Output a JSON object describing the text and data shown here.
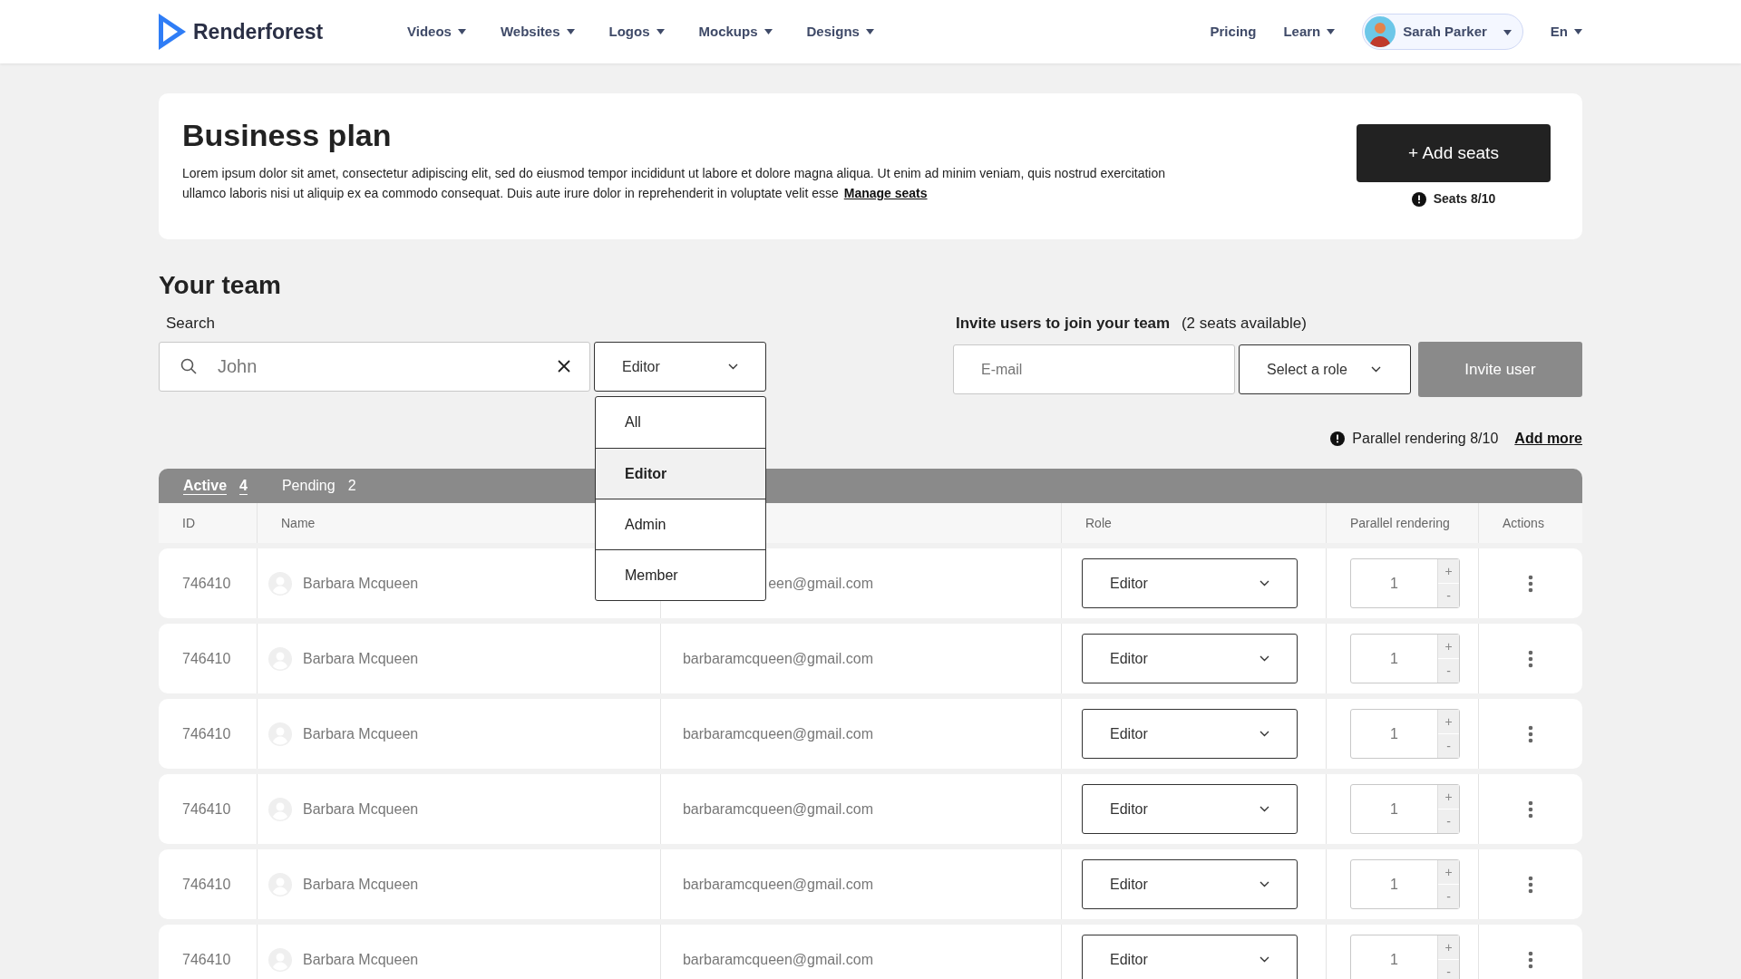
{
  "nav": {
    "logo": "Renderforest",
    "menus": [
      {
        "label": "Videos"
      },
      {
        "label": "Websites"
      },
      {
        "label": "Logos"
      },
      {
        "label": "Mockups"
      },
      {
        "label": "Designs"
      }
    ],
    "links": [
      {
        "label": "Pricing",
        "dropdown": false
      },
      {
        "label": "Learn",
        "dropdown": true
      }
    ],
    "user": {
      "name": "Sarah Parker"
    },
    "language": "En"
  },
  "plan": {
    "title": "Business plan",
    "description": "Lorem ipsum dolor sit amet, consectetur adipiscing elit, sed do eiusmod tempor incididunt ut labore et dolore magna aliqua. Ut enim ad minim veniam, quis nostrud exercitation ullamco laboris nisi ut aliquip ex ea commodo consequat. Duis aute irure dolor in reprehenderit in voluptate velit esse",
    "link": "Manage seats",
    "button": "+ Add seats",
    "seats": "Seats 8/10"
  },
  "team": {
    "title": "Your team",
    "search": {
      "label": "Search",
      "value": "John"
    },
    "filter": {
      "value": "Editor",
      "expanded": true,
      "options": [
        {
          "label": "All",
          "selected": false
        },
        {
          "label": "Editor",
          "selected": true
        },
        {
          "label": "Admin",
          "selected": false
        },
        {
          "label": "Member",
          "selected": false
        }
      ]
    },
    "invite": {
      "title": "Invite users to join your team",
      "note": "(2 seats available)",
      "placeholder": "E-mail",
      "role": "Select a role",
      "button": "Invite user",
      "disabled": true
    },
    "rendering": {
      "text": "Parallel rendering 8/10",
      "link": "Add more"
    },
    "tabs": [
      {
        "label": "Active",
        "count": "4",
        "selected": true
      },
      {
        "label": "Pending",
        "count": "2",
        "selected": false
      }
    ],
    "table": {
      "columns": [
        "ID",
        "Name",
        "Role",
        "Parallel rendering",
        "Actions"
      ],
      "rows": [
        {
          "id": "746410",
          "name": "Barbara Mcqueen",
          "email": "een@gmail.com",
          "role": "Editor",
          "rendering": "1",
          "increment": "+",
          "decrement": "-"
        },
        {
          "id": "746410",
          "name": "Barbara Mcqueen",
          "email": "barbaramcqueen@gmail.com",
          "role": "Editor",
          "rendering": "1",
          "increment": "+",
          "decrement": "-"
        },
        {
          "id": "746410",
          "name": "Barbara Mcqueen",
          "email": "barbaramcqueen@gmail.com",
          "role": "Editor",
          "rendering": "1",
          "increment": "+",
          "decrement": "-"
        },
        {
          "id": "746410",
          "name": "Barbara Mcqueen",
          "email": "barbaramcqueen@gmail.com",
          "role": "Editor",
          "rendering": "1",
          "increment": "+",
          "decrement": "-"
        },
        {
          "id": "746410",
          "name": "Barbara Mcqueen",
          "email": "barbaramcqueen@gmail.com",
          "role": "Editor",
          "rendering": "1",
          "increment": "+",
          "decrement": "-"
        },
        {
          "id": "746410",
          "name": "Barbara Mcqueen",
          "email": "barbaramcqueen@gmail.com",
          "role": "Editor",
          "rendering": "1",
          "increment": "+",
          "decrement": "-"
        }
      ]
    }
  }
}
